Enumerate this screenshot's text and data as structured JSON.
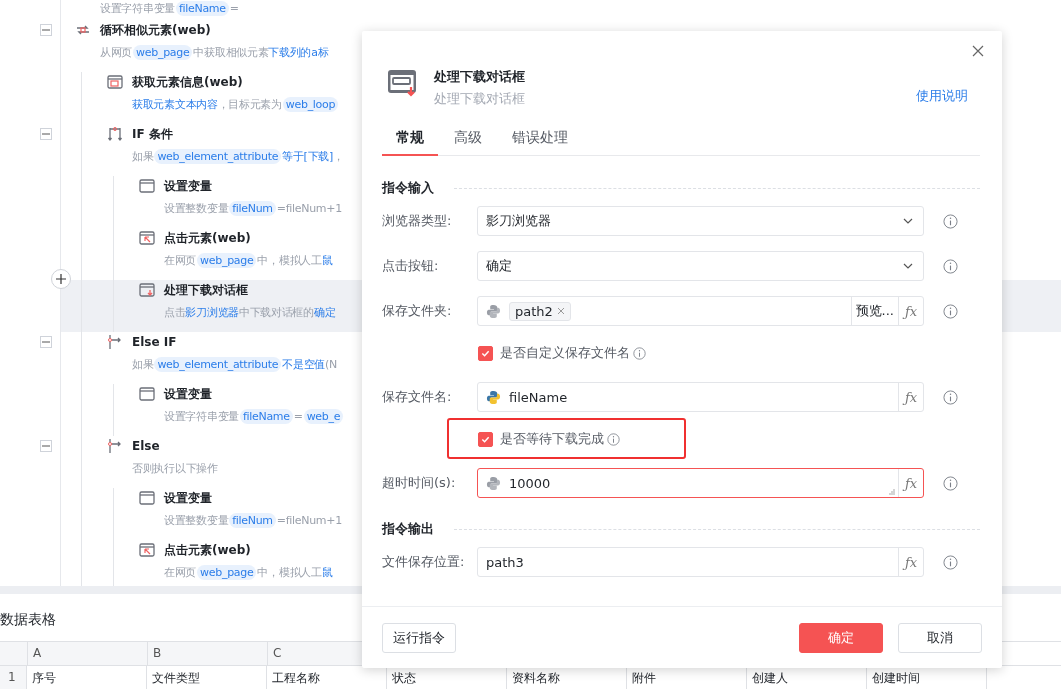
{
  "workflow": {
    "top_row": {
      "desc": [
        {
          "kind": "text",
          "text": "设置字符串变量"
        },
        {
          "kind": "var",
          "text": "fileName"
        },
        {
          "kind": "text",
          "text": "="
        }
      ]
    },
    "steps": [
      {
        "kind": "loop",
        "title": "循环相似元素(web)",
        "selected": false,
        "expanded": true,
        "desc": [
          {
            "kind": "text",
            "text": "从网页"
          },
          {
            "kind": "var",
            "text": "web_page"
          },
          {
            "kind": "text",
            "text": "中获取相似元素"
          },
          {
            "kind": "link",
            "text": "下载列的a标"
          }
        ],
        "children": [
          {
            "kind": "get-info",
            "title": "获取元素信息(web)",
            "selected": false,
            "desc": [
              {
                "kind": "link",
                "text": "获取元素文本内容"
              },
              {
                "kind": "text",
                "text": "，目标元素为"
              },
              {
                "kind": "var",
                "text": "web_loop"
              }
            ]
          },
          {
            "kind": "if",
            "title": "IF 条件",
            "selected": false,
            "expanded": true,
            "desc": [
              {
                "kind": "text",
                "text": "如果"
              },
              {
                "kind": "var",
                "text": "web_element_attribute"
              },
              {
                "kind": "link",
                "text": "等于[下载]"
              },
              {
                "kind": "text",
                "text": "，"
              }
            ],
            "children": [
              {
                "kind": "set-variable",
                "title": "设置变量",
                "selected": false,
                "desc": [
                  {
                    "kind": "text",
                    "text": "设置整数变量"
                  },
                  {
                    "kind": "var",
                    "text": "fileNum"
                  },
                  {
                    "kind": "text",
                    "text": "=fileNum+1"
                  }
                ]
              },
              {
                "kind": "click",
                "title": "点击元素(web)",
                "selected": false,
                "desc": [
                  {
                    "kind": "text",
                    "text": "在网页"
                  },
                  {
                    "kind": "var",
                    "text": "web_page"
                  },
                  {
                    "kind": "text",
                    "text": "中，模拟人工"
                  },
                  {
                    "kind": "link",
                    "text": "鼠"
                  }
                ]
              },
              {
                "kind": "download-dialog",
                "title": "处理下载对话框",
                "selected": true,
                "desc": [
                  {
                    "kind": "text",
                    "text": "点击"
                  },
                  {
                    "kind": "link",
                    "text": "影刀浏览器"
                  },
                  {
                    "kind": "text",
                    "text": "中下载对话框的"
                  },
                  {
                    "kind": "link",
                    "text": "确定"
                  }
                ]
              }
            ]
          },
          {
            "kind": "else-if",
            "title": "Else IF",
            "selected": false,
            "expanded": true,
            "desc": [
              {
                "kind": "text",
                "text": "如果"
              },
              {
                "kind": "var",
                "text": "web_element_attribute"
              },
              {
                "kind": "link",
                "text": "不是空值"
              },
              {
                "kind": "text",
                "text": "(N"
              }
            ],
            "children": [
              {
                "kind": "set-variable",
                "title": "设置变量",
                "selected": false,
                "desc": [
                  {
                    "kind": "text",
                    "text": "设置字符串变量"
                  },
                  {
                    "kind": "var",
                    "text": "fileName"
                  },
                  {
                    "kind": "text",
                    "text": "="
                  },
                  {
                    "kind": "var",
                    "text": "web_e"
                  }
                ]
              }
            ]
          },
          {
            "kind": "else",
            "title": "Else",
            "selected": false,
            "expanded": true,
            "desc": [
              {
                "kind": "text",
                "text": "否则执行以下操作"
              }
            ],
            "children": [
              {
                "kind": "set-variable",
                "title": "设置变量",
                "selected": false,
                "desc": [
                  {
                    "kind": "text",
                    "text": "设置整数变量"
                  },
                  {
                    "kind": "var",
                    "text": "fileNum"
                  },
                  {
                    "kind": "text",
                    "text": "=fileNum+1"
                  }
                ]
              },
              {
                "kind": "click",
                "title": "点击元素(web)",
                "selected": false,
                "desc": [
                  {
                    "kind": "text",
                    "text": "在网页"
                  },
                  {
                    "kind": "var",
                    "text": "web_page"
                  },
                  {
                    "kind": "text",
                    "text": "中，模拟人工"
                  },
                  {
                    "kind": "link",
                    "text": "鼠"
                  }
                ]
              }
            ]
          }
        ]
      }
    ]
  },
  "data_table": {
    "title": "数据表格",
    "columns": [
      "A",
      "B",
      "C"
    ],
    "rows": [
      {
        "number": "1",
        "cells": [
          "序号",
          "文件类型",
          "工程名称",
          "状态",
          "资料名称",
          "附件",
          "创建人",
          "创建时间"
        ]
      }
    ]
  },
  "dialog": {
    "title": "处理下载对话框",
    "subtitle": "处理下载对话框",
    "help_link": "使用说明",
    "tabs": [
      {
        "label": "常规",
        "selected": true
      },
      {
        "label": "高级",
        "selected": false
      },
      {
        "label": "错误处理",
        "selected": false
      }
    ],
    "sections": [
      {
        "title": "指令输入",
        "rows": [
          {
            "kind": "select",
            "label": "浏览器类型:",
            "value": "影刀浏览器"
          },
          {
            "kind": "select",
            "label": "点击按钮:",
            "value": "确定"
          },
          {
            "kind": "tag-field",
            "label": "保存文件夹:",
            "tag": "path2",
            "button": "预览...",
            "fx": "ƒx",
            "python_active": false
          },
          {
            "kind": "checkbox",
            "label": "是否自定义保存文件名",
            "checked": true,
            "highlighted": false
          },
          {
            "kind": "text-field",
            "label": "保存文件名:",
            "value": "fileName",
            "fx": "ƒx",
            "python_active": true,
            "focused": false
          },
          {
            "kind": "checkbox",
            "label": "是否等待下载完成",
            "checked": true,
            "highlighted": true
          },
          {
            "kind": "text-field",
            "label": "超时时间(s):",
            "value": "10000",
            "fx": "ƒx",
            "python_active": false,
            "focused": true
          }
        ]
      },
      {
        "title": "指令输出",
        "rows": [
          {
            "kind": "output-field",
            "label": "文件保存位置:",
            "value": "path3",
            "fx": "ƒx"
          }
        ]
      }
    ],
    "footer": {
      "run_button": "运行指令",
      "ok_button": "确定",
      "cancel_button": "取消"
    }
  }
}
